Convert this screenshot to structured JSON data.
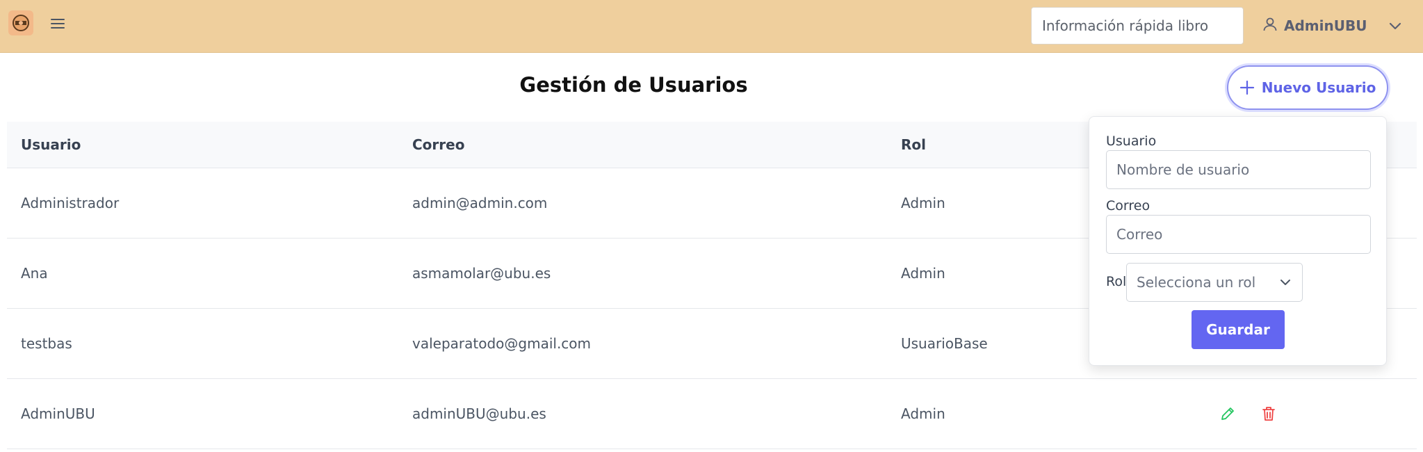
{
  "header": {
    "quick_search_placeholder": "Información rápida libro",
    "username": "AdminUBU"
  },
  "page": {
    "title": "Gestión de Usuarios",
    "new_user_label": "Nuevo Usuario"
  },
  "table": {
    "columns": [
      "Usuario",
      "Correo",
      "Rol"
    ],
    "rows": [
      {
        "usuario": "Administrador",
        "correo": "admin@admin.com",
        "rol": "Admin"
      },
      {
        "usuario": "Ana",
        "correo": "asmamolar@ubu.es",
        "rol": "Admin"
      },
      {
        "usuario": "testbas",
        "correo": "valeparatodo@gmail.com",
        "rol": "UsuarioBase"
      },
      {
        "usuario": "AdminUBU",
        "correo": "adminUBU@ubu.es",
        "rol": "Admin"
      }
    ]
  },
  "form": {
    "usuario_label": "Usuario",
    "usuario_placeholder": "Nombre de usuario",
    "correo_label": "Correo",
    "correo_placeholder": "Correo",
    "rol_label": "Rol",
    "rol_select_value": "Selecciona un rol",
    "save_label": "Guardar"
  },
  "colors": {
    "topbar": "#efcf9d",
    "accent": "#6366f1",
    "edit": "#22c55e",
    "delete": "#ef4444"
  },
  "icons": [
    "logo-icon",
    "menu-icon",
    "user-icon",
    "chevron-down-icon",
    "plus-icon",
    "pencil-icon",
    "trash-icon"
  ]
}
